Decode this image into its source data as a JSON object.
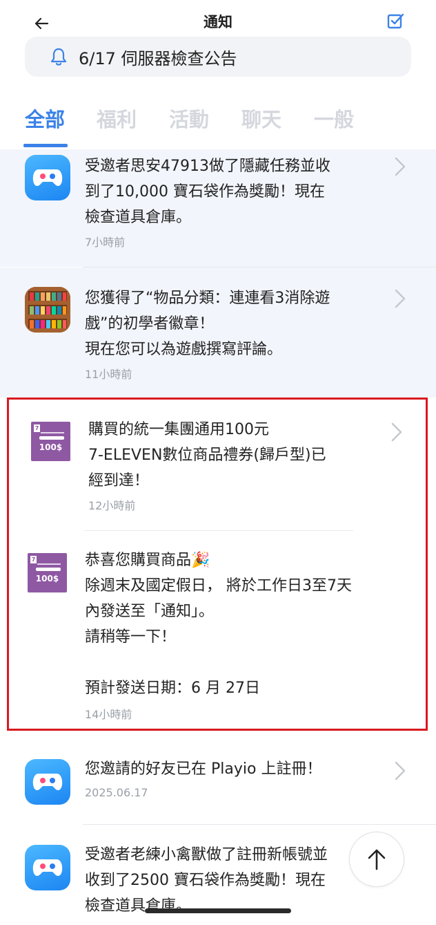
{
  "header": {
    "title": "通知"
  },
  "announcement": {
    "text": "6/17 伺服器檢查公告"
  },
  "tabs": [
    {
      "label": "全部",
      "active": true
    },
    {
      "label": "福利"
    },
    {
      "label": "活動"
    },
    {
      "label": "聊天"
    },
    {
      "label": "一般"
    }
  ],
  "notifications": [
    {
      "icon": "game-controller-icon",
      "text": "受邀者思安47913做了隱藏任務並收\n到了10,000 寶石袋作為獎勵！現在\n檢查道具倉庫。",
      "time": "7小時前"
    },
    {
      "icon": "shelf-game-icon",
      "text": "您獲得了“物品分類：連連看3消除遊\n戲”的初學者徽章！\n現在您可以為遊戲撰寫評論。",
      "time": "11小時前"
    },
    {
      "icon": "voucher-icon",
      "text": "購買的統一集團通用100元\n7-ELEVEN數位商品禮券(歸戶型)已\n經到達！",
      "time": "12小時前"
    },
    {
      "icon": "voucher-icon",
      "text": "恭喜您購買商品🎉\n除週末及國定假日， 將於工作日3至7天\n內發送至「通知」。\n請稍等一下！\n\n預計發送日期：6 月 27日",
      "time": "14小時前"
    },
    {
      "icon": "game-controller-icon",
      "text": "您邀請的好友已在 Playio 上註冊！",
      "time": "2025.06.17"
    },
    {
      "icon": "game-controller-icon",
      "text": "受邀者老練小禽獸做了註冊新帳號並\n收到了2500 寶石袋作為獎勵！現在\n檢查道具倉庫。",
      "time": ""
    }
  ],
  "voucher": {
    "amount": "100$",
    "badge": "7"
  },
  "colors": {
    "accent": "#3b82e8",
    "highlight_border": "#d9191f",
    "unread_bg": "#f2f5fb"
  }
}
